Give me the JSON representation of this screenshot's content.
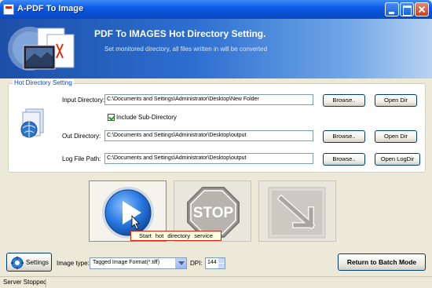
{
  "window": {
    "title": "A-PDF To Image"
  },
  "header": {
    "title": "PDF To IMAGES Hot Directory Setting.",
    "subtitle": "Set monitored directory, all files written in will be converted"
  },
  "group": {
    "label": "Hot Directory Setting",
    "input_dir": {
      "label": "Input Directory:",
      "value": "C:\\Documents and Settings\\Administrator\\Desktop\\New Folder",
      "browse": "Browse..",
      "open": "Open Dir"
    },
    "include_sub": {
      "label": "Include Sub-Directory",
      "checked": true
    },
    "out_dir": {
      "label": "Out Directory:",
      "value": "C:\\Documents and Settings\\Administrator\\Desktop\\output",
      "browse": "Browse..",
      "open": "Open Dir"
    },
    "log_file": {
      "label": "Log File Path:",
      "value": "C:\\Documents and Settings\\Administrator\\Desktop\\output",
      "browse": "Browse..",
      "open": "Open LogDir"
    }
  },
  "actions": {
    "tooltip": "Start hot directory service",
    "stop_label": "STOP"
  },
  "bottom": {
    "settings_label": "Settings",
    "image_type_label": "Image type:",
    "image_type_value": "Tagged Image Format(*.tiff)",
    "dpi_label": "DPI:",
    "dpi_value": "144",
    "return_label": "Return to Batch Mode"
  },
  "status": {
    "text": "Server Stopped"
  },
  "colors": {
    "accent": "#0a4fd1",
    "stop_red": "#e42222",
    "group_label": "#0046d5"
  }
}
